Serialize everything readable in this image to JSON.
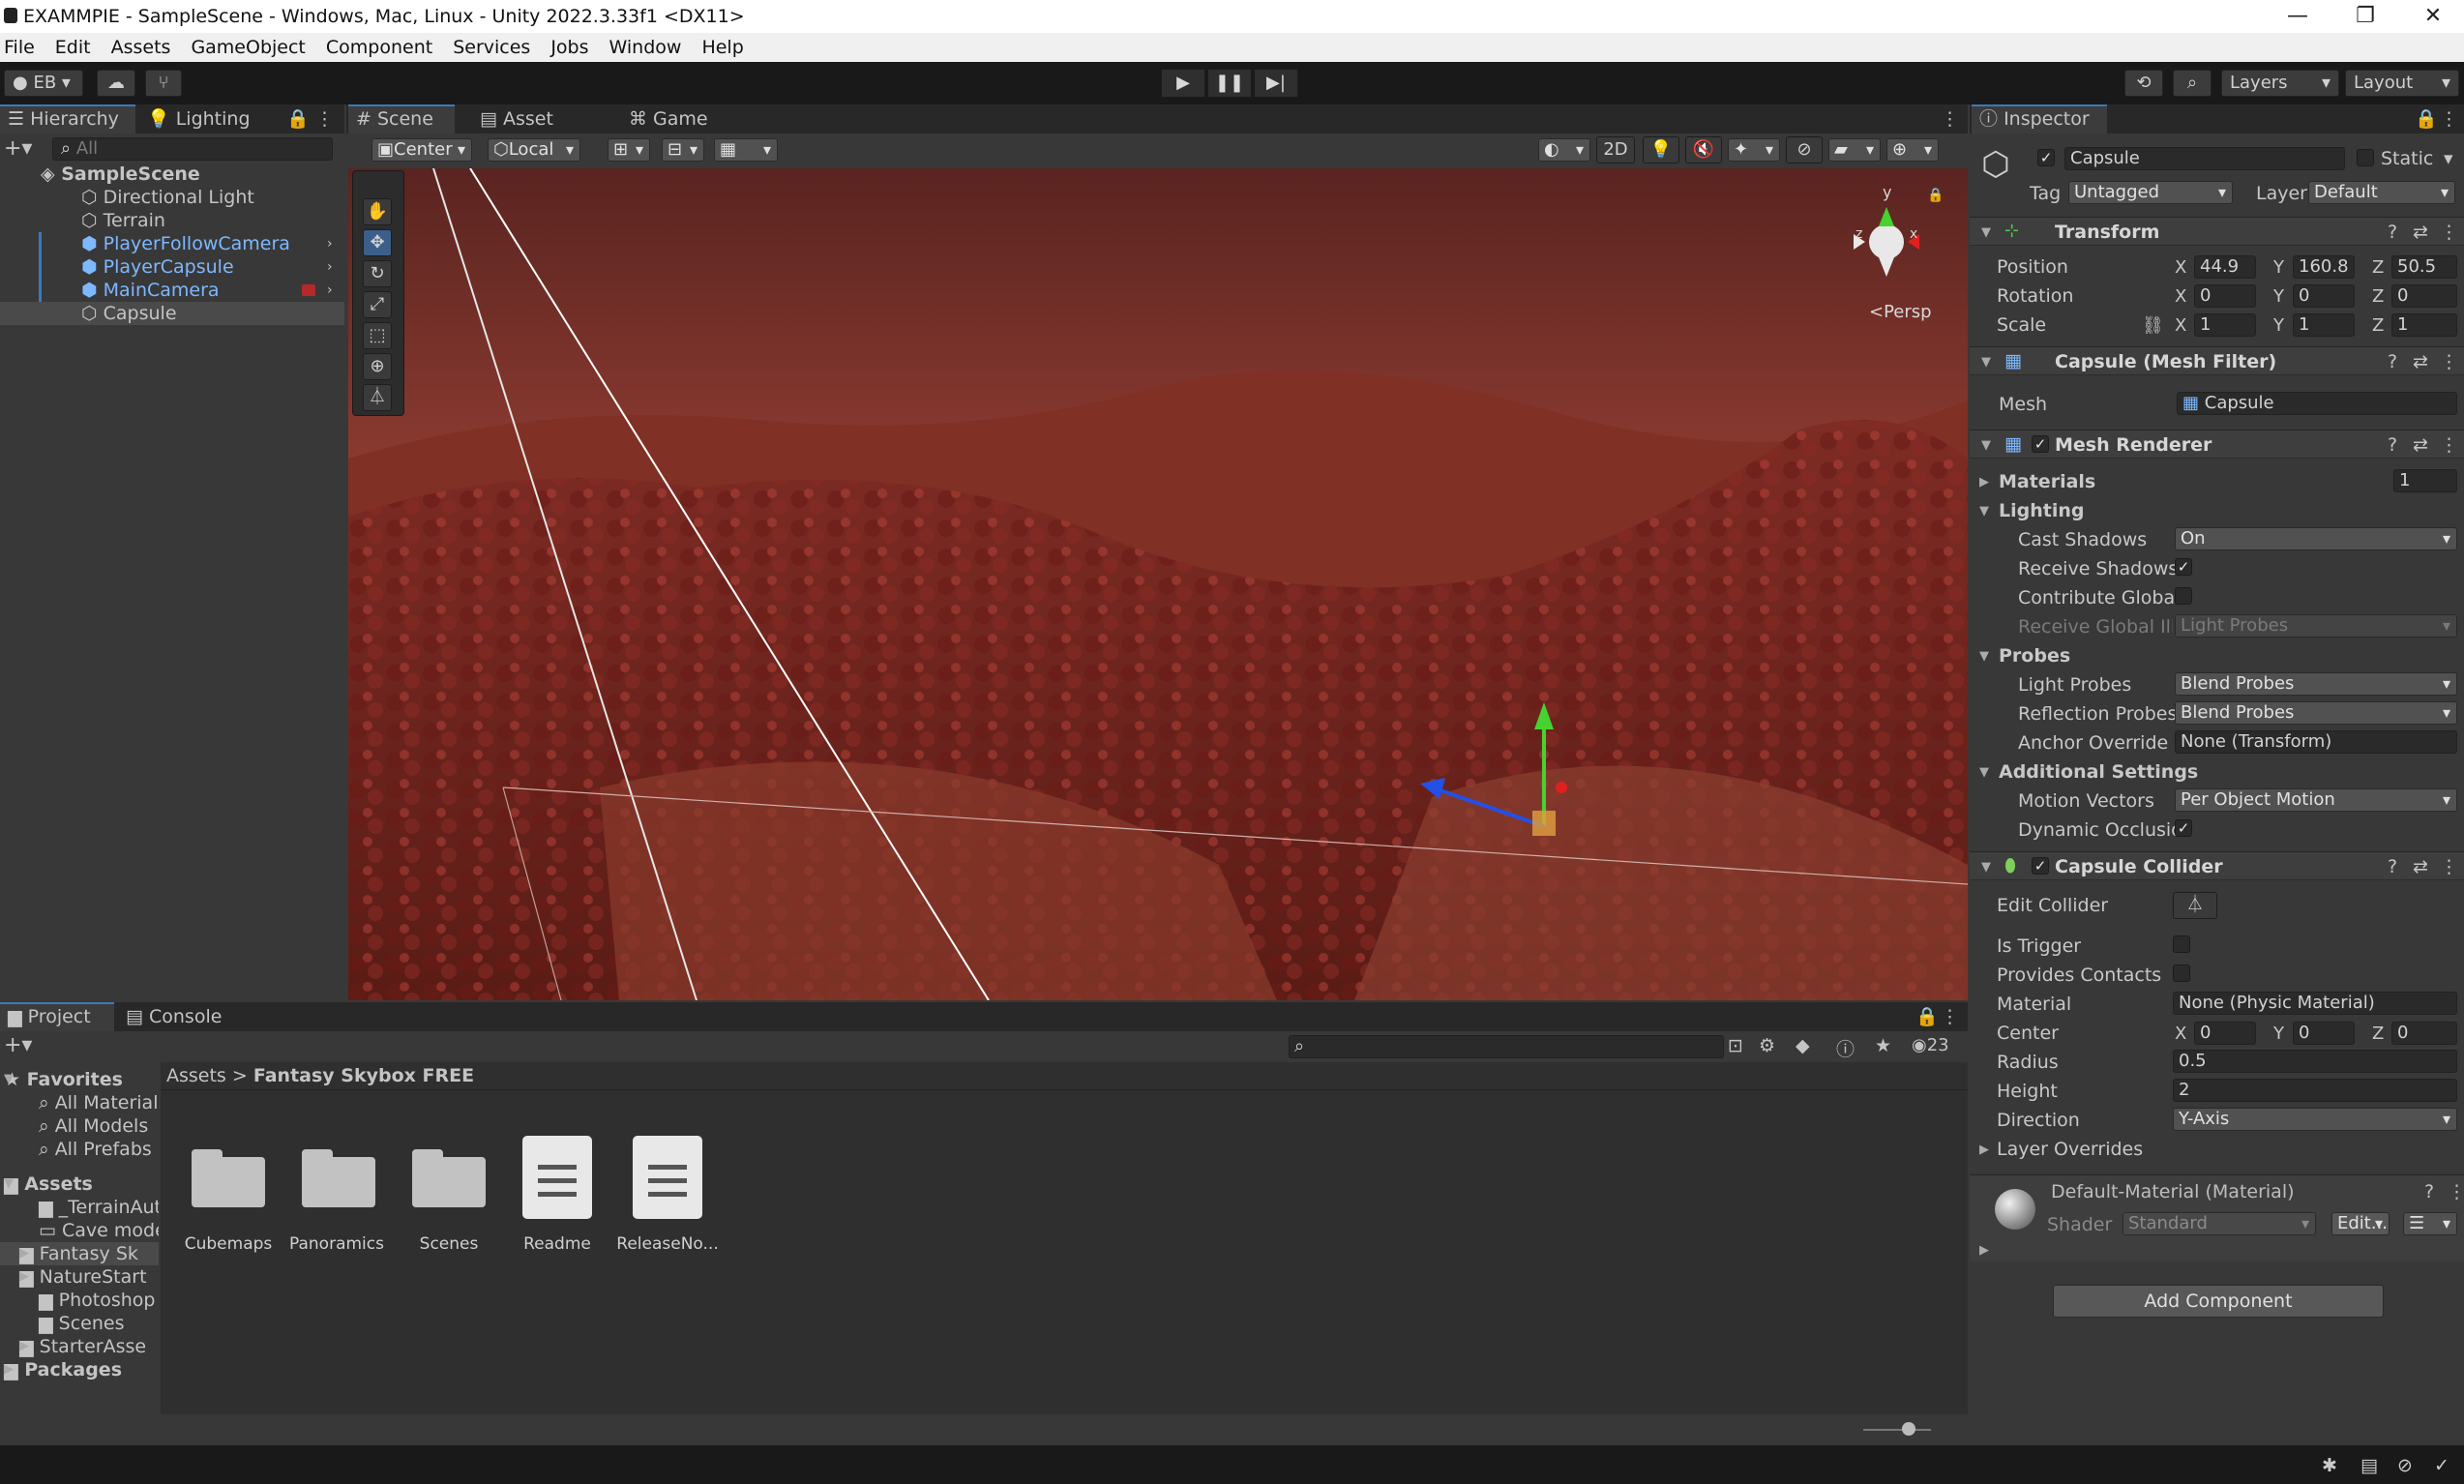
{
  "window": {
    "title": "EXAMMPIE - SampleScene - Windows, Mac, Linux - Unity 2022.3.33f1 <DX11>",
    "minimize": "—",
    "maximize": "❐",
    "close": "✕"
  },
  "menu": [
    "File",
    "Edit",
    "Assets",
    "GameObject",
    "Component",
    "Services",
    "Jobs",
    "Window",
    "Help"
  ],
  "toolbar": {
    "account": "EB",
    "layers": "Layers",
    "layout": "Layout"
  },
  "hierarchy": {
    "tabs": [
      "Hierarchy",
      "Lighting"
    ],
    "search_placeholder": "All",
    "scene": "SampleScene",
    "items": [
      {
        "label": "Directional Light",
        "blue": false
      },
      {
        "label": "Terrain",
        "blue": false
      },
      {
        "label": "PlayerFollowCamera",
        "blue": true
      },
      {
        "label": "PlayerCapsule",
        "blue": true
      },
      {
        "label": "MainCamera",
        "blue": true
      },
      {
        "label": "Capsule",
        "blue": false
      }
    ]
  },
  "scene_view": {
    "tabs": [
      "Scene",
      "Asset Store",
      "Game"
    ],
    "pivot": "Center",
    "space": "Local",
    "mode_2d": "2D",
    "persp": "Persp"
  },
  "inspector": {
    "tab": "Inspector",
    "object_name": "Capsule",
    "static_label": "Static",
    "tag_label": "Tag",
    "tag": "Untagged",
    "layer_label": "Layer",
    "layer": "Default",
    "transform": {
      "title": "Transform",
      "position_label": "Position",
      "rotation_label": "Rotation",
      "scale_label": "Scale",
      "position": [
        "44.9",
        "160.8",
        "50.5"
      ],
      "rotation": [
        "0",
        "0",
        "0"
      ],
      "scale": [
        "1",
        "1",
        "1"
      ]
    },
    "mesh_filter": {
      "title": "Capsule (Mesh Filter)",
      "mesh_label": "Mesh",
      "mesh": "Capsule"
    },
    "mesh_renderer": {
      "title": "Mesh Renderer",
      "materials_label": "Materials",
      "materials_count": "1",
      "lighting_label": "Lighting",
      "cast_shadows_label": "Cast Shadows",
      "cast_shadows": "On",
      "receive_shadows_label": "Receive Shadows",
      "contribute_gi_label": "Contribute Global",
      "receive_gi_label": "Receive Global Illu",
      "receive_gi": "Light Probes",
      "probes_label": "Probes",
      "light_probes_label": "Light Probes",
      "light_probes": "Blend Probes",
      "reflection_probes_label": "Reflection Probes",
      "reflection_probes": "Blend Probes",
      "anchor_override_label": "Anchor Override",
      "anchor_override": "None (Transform)",
      "additional_label": "Additional Settings",
      "motion_vectors_label": "Motion Vectors",
      "motion_vectors": "Per Object Motion",
      "dynamic_occlusion_label": "Dynamic Occlusio"
    },
    "capsule_collider": {
      "title": "Capsule Collider",
      "edit_collider_label": "Edit Collider",
      "is_trigger_label": "Is Trigger",
      "provides_contacts_label": "Provides Contacts",
      "material_label": "Material",
      "material": "None (Physic Material)",
      "center_label": "Center",
      "center": [
        "0",
        "0",
        "0"
      ],
      "radius_label": "Radius",
      "radius": "0.5",
      "height_label": "Height",
      "height": "2",
      "direction_label": "Direction",
      "direction": "Y-Axis",
      "layer_overrides_label": "Layer Overrides"
    },
    "material": {
      "title": "Default-Material (Material)",
      "shader_label": "Shader",
      "shader": "Standard",
      "edit": "Edit..."
    },
    "add_component": "Add Component"
  },
  "project": {
    "tabs": [
      "Project",
      "Console"
    ],
    "hidden_count": "23",
    "breadcrumb_root": "Assets",
    "breadcrumb_current": "Fantasy Skybox FREE",
    "favorites_label": "Favorites",
    "favorites": [
      "All Material",
      "All Models",
      "All Prefabs"
    ],
    "assets_label": "Assets",
    "asset_folders": [
      "_TerrainAut",
      "Cave mode",
      "Fantasy Sk",
      "NatureStart",
      "Photoshop",
      "Scenes",
      "StarterAsse"
    ],
    "packages_label": "Packages",
    "grid_items": [
      {
        "label": "Cubemaps",
        "kind": "folder"
      },
      {
        "label": "Panoramics",
        "kind": "folder"
      },
      {
        "label": "Scenes",
        "kind": "folder"
      },
      {
        "label": "Readme",
        "kind": "doc"
      },
      {
        "label": "ReleaseNo...",
        "kind": "doc"
      }
    ]
  },
  "colors": {
    "accent": "#3a79bb",
    "prefab_blue": "#7eb8ff",
    "sky": "#8a2f24",
    "terrain": "#9a3a30"
  }
}
